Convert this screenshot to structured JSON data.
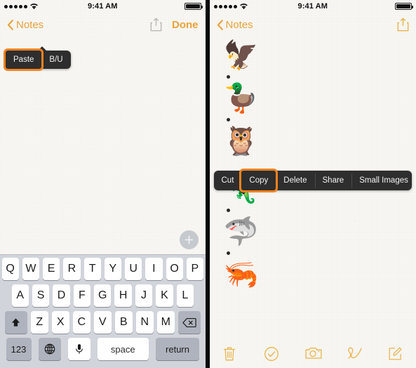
{
  "status_bar": {
    "signal_dots": 5,
    "wifi_icon": "wifi-icon",
    "time": "9:41 AM",
    "battery_icon": "battery-full-icon"
  },
  "left_phone": {
    "nav": {
      "back_label": "Notes",
      "back_icon": "chevron-left-icon",
      "share_icon": "share-icon",
      "done_label": "Done"
    },
    "edit_menu": {
      "items": [
        {
          "label": "Paste",
          "selected": true
        },
        {
          "label": "B/U",
          "selected": false
        }
      ]
    },
    "add_button_icon": "plus-icon",
    "keyboard": {
      "row1": [
        "Q",
        "W",
        "E",
        "R",
        "T",
        "Y",
        "U",
        "I",
        "O",
        "P"
      ],
      "row2": [
        "A",
        "S",
        "D",
        "F",
        "G",
        "H",
        "J",
        "K",
        "L"
      ],
      "row3": [
        "Z",
        "X",
        "C",
        "V",
        "B",
        "N",
        "M"
      ],
      "shift_icon": "shift-arrow-up-icon",
      "backspace_icon": "backspace-delete-icon",
      "numbers_label": "123",
      "globe_icon": "globe-language-icon",
      "mic_icon": "microphone-icon",
      "space_label": "space",
      "return_label": "return"
    }
  },
  "right_phone": {
    "nav": {
      "back_label": "Notes",
      "back_icon": "chevron-left-icon",
      "share_icon": "share-icon"
    },
    "note_items": [
      {
        "type": "image",
        "icon": "eagle-emoji",
        "glyph": "🦅"
      },
      {
        "type": "bullet"
      },
      {
        "type": "image",
        "icon": "duck-emoji",
        "glyph": "🦆"
      },
      {
        "type": "bullet"
      },
      {
        "type": "image",
        "icon": "owl-emoji",
        "glyph": "🦉"
      },
      {
        "type": "image",
        "icon": "lizard-emoji",
        "glyph": "🦎"
      },
      {
        "type": "bullet"
      },
      {
        "type": "image",
        "icon": "shark-emoji",
        "glyph": "🦈"
      },
      {
        "type": "bullet"
      },
      {
        "type": "image",
        "icon": "shrimp-emoji",
        "glyph": "🦐"
      }
    ],
    "context_menu": {
      "items": [
        {
          "label": "Cut",
          "selected": false
        },
        {
          "label": "Copy",
          "selected": true
        },
        {
          "label": "Delete",
          "selected": false
        },
        {
          "label": "Share",
          "selected": false
        },
        {
          "label": "Small Images",
          "selected": false
        }
      ]
    },
    "toolbar": {
      "items": [
        {
          "icon": "trash-icon"
        },
        {
          "icon": "checkmark-circle-icon"
        },
        {
          "icon": "camera-icon"
        },
        {
          "icon": "squiggle-draw-icon"
        },
        {
          "icon": "compose-pencil-icon"
        }
      ]
    }
  },
  "colors": {
    "accent": "#e8a33d",
    "highlight": "#f5821f",
    "menu_bg": "#2e2e2e",
    "paper": "#f8f7f3",
    "keyboard_bg": "#d1d4da"
  }
}
